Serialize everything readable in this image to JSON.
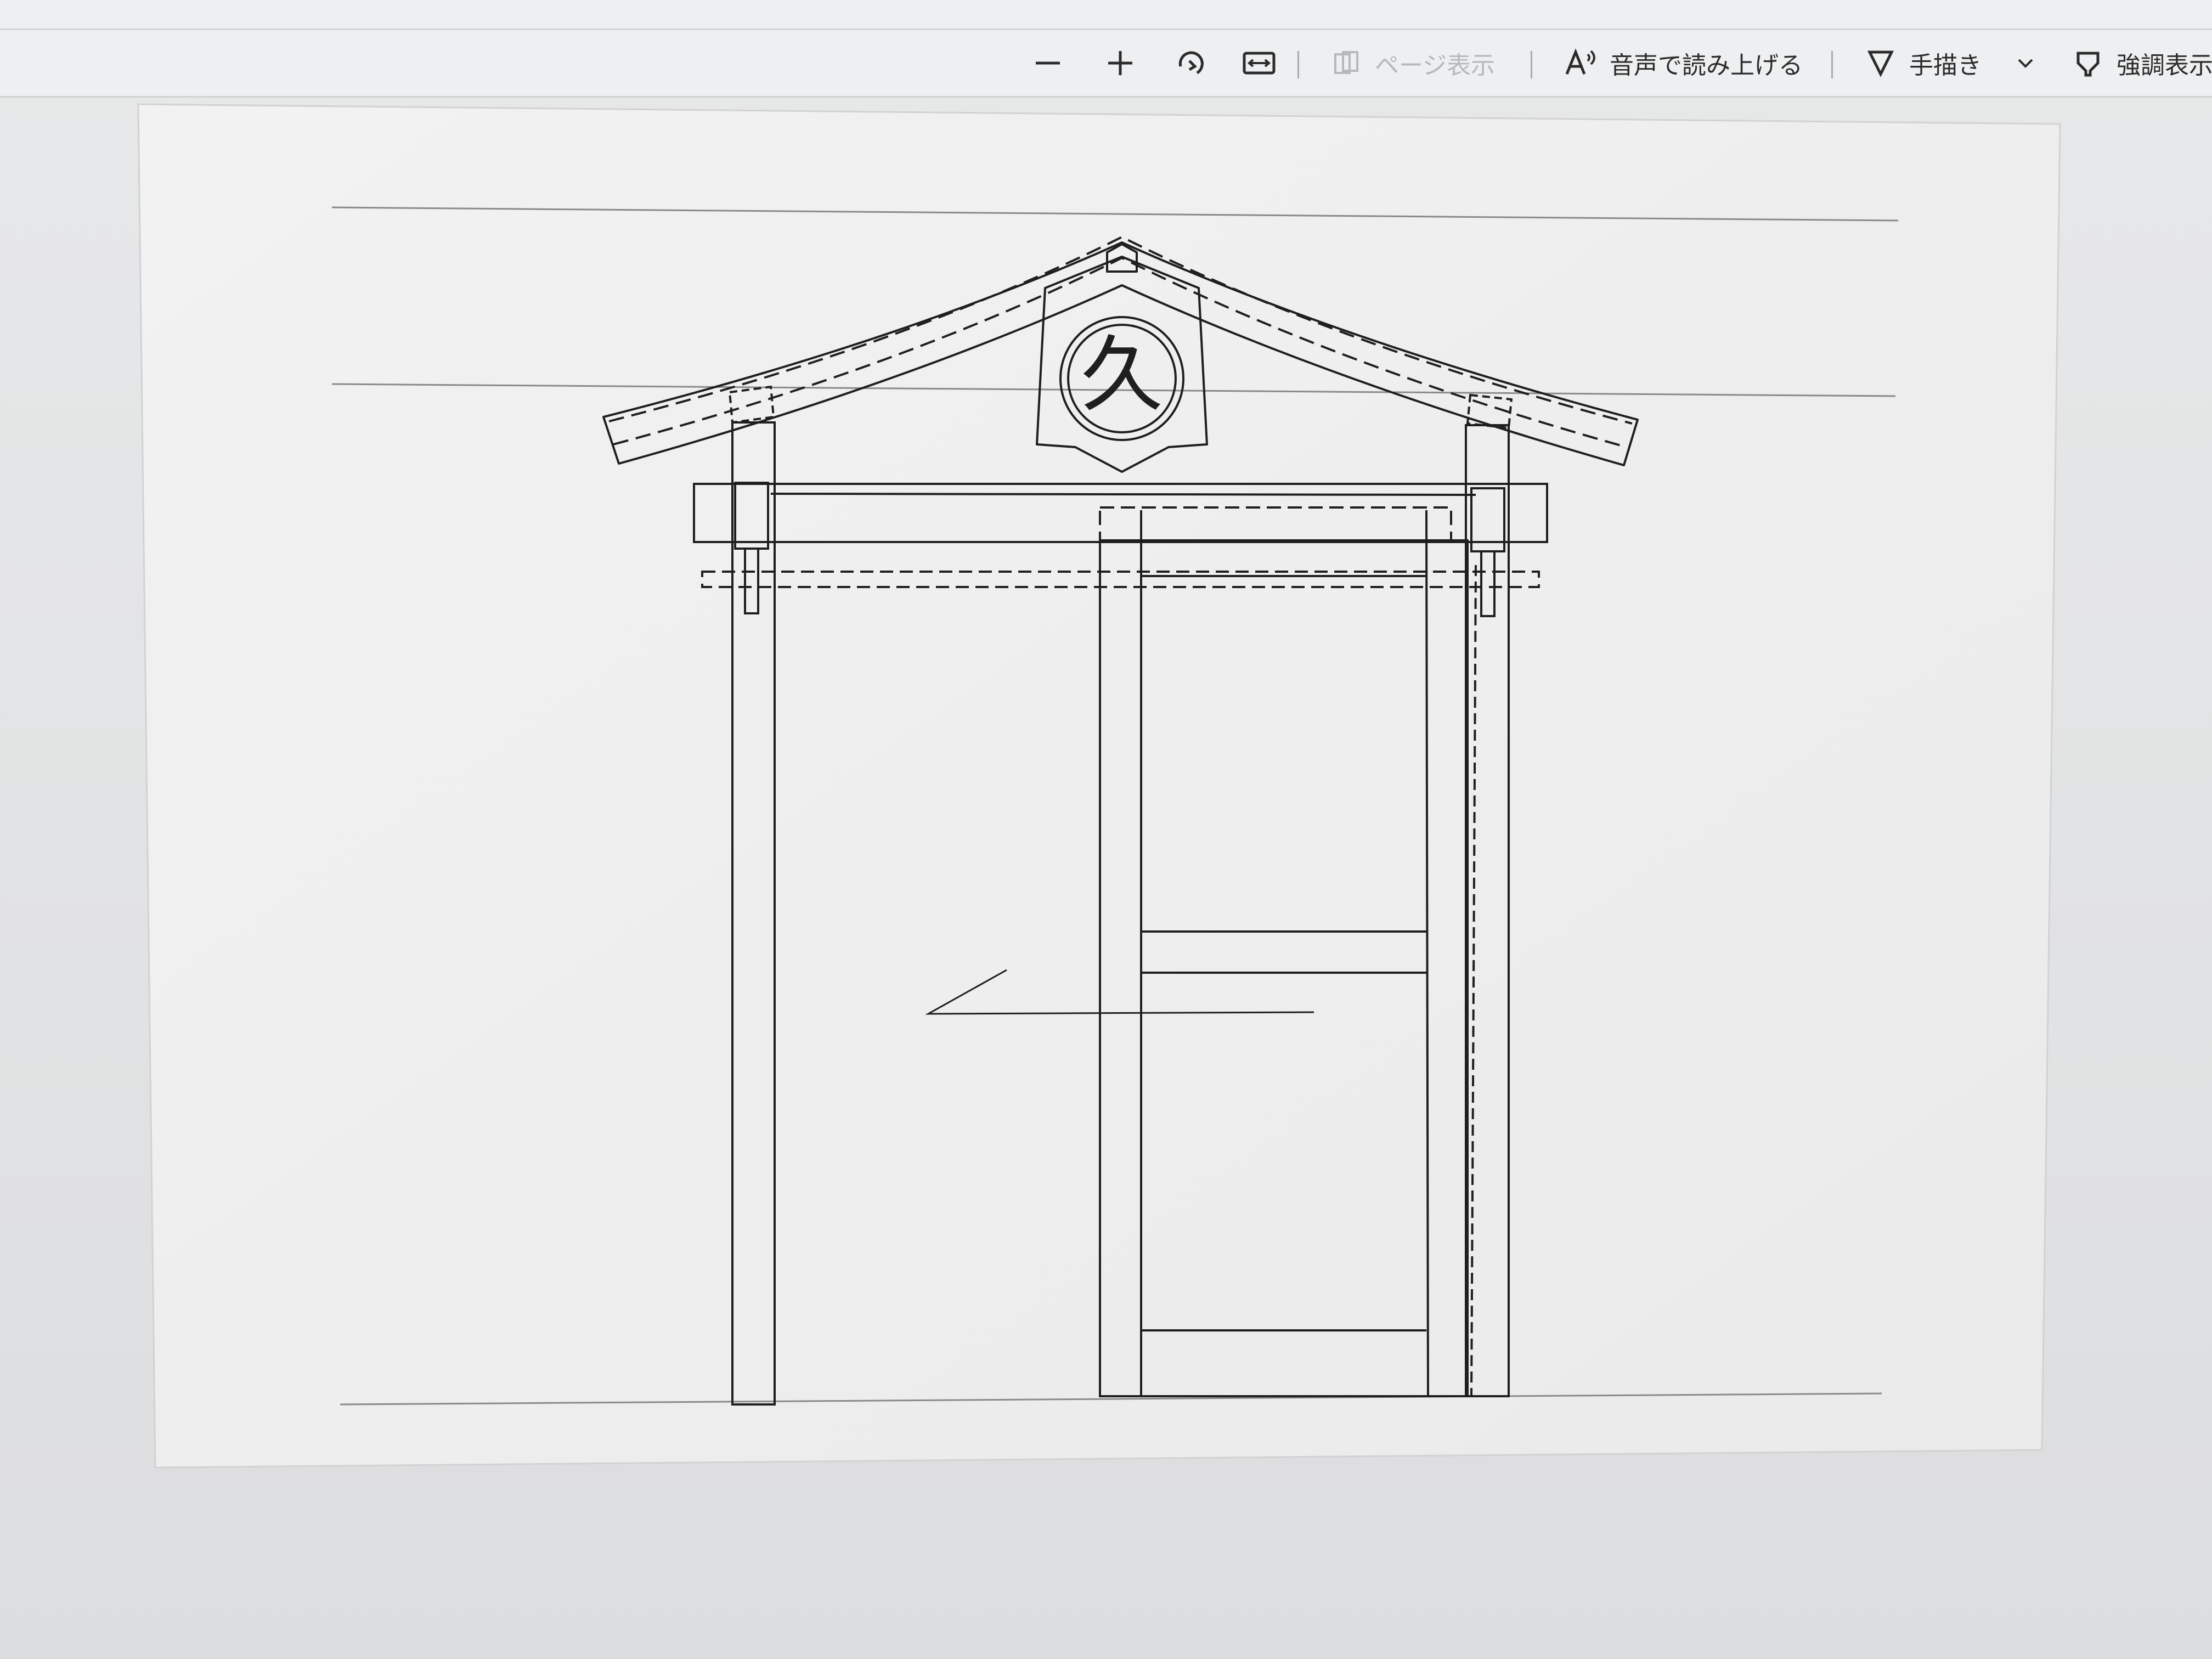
{
  "toolbar": {
    "zoom_out_icon": "minus-icon",
    "zoom_in_icon": "plus-icon",
    "rotate_icon": "rotate-icon",
    "fit_width_icon": "fit-width-icon",
    "page_view_label": "ページ表示",
    "read_aloud_label": "音声で読み上げる",
    "draw_label": "手描き",
    "highlight_label": "強調表示"
  },
  "drawing": {
    "emblem_character": "久"
  },
  "colors": {
    "toolbar_bg": "#eeeff0",
    "page_bg": "#f1f1f1",
    "line": "#1f1f1f",
    "guide_line": "#8a8a8a",
    "disabled_text": "#b7b8ba"
  }
}
